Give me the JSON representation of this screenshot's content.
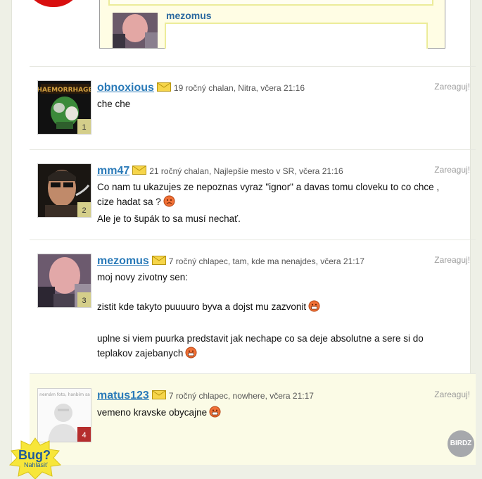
{
  "preview": {
    "username": "mezomus"
  },
  "comments": [
    {
      "username": "obnoxious",
      "info": "19 ročný chalan, Nitra, včera 21:16",
      "reply": "Zareaguj!",
      "number": "1",
      "lines": [
        "che che"
      ]
    },
    {
      "username": "mm47",
      "info": "21 ročný chalan, Najlepšie mesto v SR, včera 21:16",
      "reply": "Zareaguj!",
      "number": "2",
      "lines": [
        "Co nam tu ukazujes ze nepoznas vyraz \"ignor\" a davas tomu cloveku to co chce ,",
        "cize hadat sa ?",
        "Ale je to šupák to sa musí nechať."
      ]
    },
    {
      "username": "mezomus",
      "info": "7 ročný chlapec, tam, kde ma nenajdes, včera 21:17",
      "reply": "Zareaguj!",
      "number": "3",
      "lines": [
        "moj novy zivotny sen:",
        "zistit kde takyto puuuuro byva a dojst mu zazvonit",
        "uplne si viem puurka predstavit jak nechape co sa deje absolutne a sere si do",
        "teplakov zajebanych"
      ]
    },
    {
      "username": "matus123",
      "info": "7 ročný chlapec, nowhere, včera 21:17",
      "reply": "Zareaguj!",
      "number": "4",
      "avatar_caption": "nemám foto, hanbím sa",
      "lines": [
        "vemeno kravske obycajne"
      ]
    }
  ],
  "bug": {
    "label": "Bug?",
    "sub": "Nahlásiť"
  },
  "badge": {
    "label": "BIRDZ"
  },
  "colors": {
    "link": "#2a7ab8",
    "highlight_bg": "#fbfbe6",
    "badge_bg": "#d4ce8a",
    "badge_red": "#b52d2d"
  }
}
